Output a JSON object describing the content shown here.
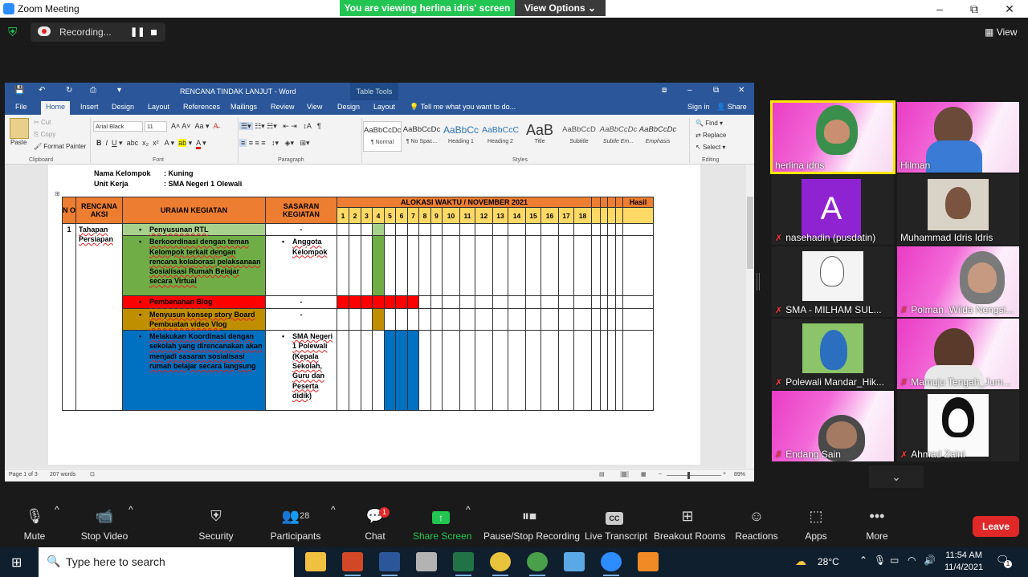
{
  "window": {
    "title": "Zoom Meeting",
    "min": "–",
    "restore": "⧉",
    "close": "✕"
  },
  "banner": {
    "viewing": "You are viewing herlina idris' screen",
    "view_options": "View Options",
    "caret": "⌄"
  },
  "recording": {
    "label": "Recording...",
    "pause": "❚❚"
  },
  "view_button": {
    "label": "View"
  },
  "word": {
    "doc_title": "RENCANA TINDAK LANJUT - Word",
    "table_tools": "Table Tools",
    "tabs": [
      "File",
      "Home",
      "Insert",
      "Design",
      "Layout",
      "References",
      "Mailings",
      "Review",
      "View",
      "Design",
      "Layout"
    ],
    "tell_me": "Tell me what you want to do...",
    "sign_in": "Sign in",
    "share": "Share",
    "clipboard": {
      "paste": "Paste",
      "cut": "Cut",
      "copy": "Copy",
      "format_painter": "Format Painter",
      "group": "Clipboard"
    },
    "font": {
      "name": "Arial Black",
      "size": "11",
      "group": "Font"
    },
    "paragraph_group": "Paragraph",
    "styles": [
      {
        "preview": "AaBbCcDc",
        "name": "¶ Normal"
      },
      {
        "preview": "AaBbCcDc",
        "name": "¶ No Spac..."
      },
      {
        "preview": "AaBbCc",
        "name": "Heading 1"
      },
      {
        "preview": "AaBbCcC",
        "name": "Heading 2"
      },
      {
        "preview": "AaB",
        "name": "Title"
      },
      {
        "preview": "AaBbCcD",
        "name": "Subtitle"
      },
      {
        "preview": "AaBbCcDc",
        "name": "Subtle Em..."
      },
      {
        "preview": "AaBbCcDc",
        "name": "Emphasis"
      }
    ],
    "styles_group": "Styles",
    "editing": {
      "find": "Find",
      "replace": "Replace",
      "select": "Select",
      "group": "Editing"
    },
    "status": {
      "page": "Page 1 of 3",
      "words": "207 words",
      "zoom": "89%"
    }
  },
  "document": {
    "kelompok_label": "Nama Kelompok",
    "kelompok_value": ": Kuning",
    "unit_label": "Unit Kerja",
    "unit_value": ": SMA Negeri 1 Olewali",
    "table": {
      "h_no": "N O",
      "h_aksi": "RENCANA AKSI",
      "h_uraian": "URAIAN KEGIATAN",
      "h_sasaran": "SASARAN KEGIATAN",
      "h_alokasi": "ALOKASI WAKTU / NOVEMBER 2021",
      "h_hasil": "Hasil",
      "days": [
        "1",
        "2",
        "3",
        "4",
        "5",
        "6",
        "7",
        "8",
        "9",
        "10",
        "11",
        "12",
        "13",
        "14",
        "15",
        "16",
        "17",
        "18",
        "",
        "",
        "",
        ""
      ],
      "row_no": "1",
      "row_aksi": "Tahapan Persiapan",
      "rows": [
        {
          "uraian": "Penyusunan RTL",
          "sasaran": "-",
          "color": "lg"
        },
        {
          "uraian": "Berkoordinasi dengan teman Kelompok terkait dengan rencana kolaborasi pelaksanaan Sosialisasi Rumah Belajar secara Virtual",
          "sasaran": "Anggota Kelompok",
          "color": "g"
        },
        {
          "uraian": "Pembenahan Blog",
          "sasaran": "-",
          "color": "r"
        },
        {
          "uraian": "Menyusun konsep story Board Pembuatan video Vlog",
          "sasaran": "-",
          "color": "go"
        },
        {
          "uraian": "Melakukan Koordinasi dengan sekolah yang direncanakan akan menjadi sasaran sosialisasi rumah belajar secara langsung",
          "sasaran": "SMA Negeri 1 Polewali (Kepala Sekolah, Guru dan Peserta didik)",
          "color": "b"
        }
      ]
    }
  },
  "participants_tiles": [
    {
      "name": "herlina idris",
      "muted": false,
      "active": true
    },
    {
      "name": "Hilman",
      "muted": false,
      "active": false
    },
    {
      "name": "nasehadin (pusdatin)",
      "muted": true,
      "avatar": "A"
    },
    {
      "name": "Muhammad Idris Idris",
      "muted": false
    },
    {
      "name": "SMA - MILHAM SUL...",
      "muted": true
    },
    {
      "name": "Polman_Wilda Nengsi...",
      "muted": true
    },
    {
      "name": "Polewali Mandar_Hik...",
      "muted": true
    },
    {
      "name": "Mamuju Tengah_Jum...",
      "muted": true
    },
    {
      "name": "Endang Sain",
      "muted": true
    },
    {
      "name": "Ahmad Zaini",
      "muted": true
    }
  ],
  "toolbar": {
    "mute": "Mute",
    "stop_video": "Stop Video",
    "security": "Security",
    "participants": "Participants",
    "participants_count": "28",
    "chat": "Chat",
    "chat_badge": "1",
    "share_screen": "Share Screen",
    "pause_stop": "Pause/Stop Recording",
    "live_transcript": "Live Transcript",
    "breakout": "Breakout Rooms",
    "reactions": "Reactions",
    "apps": "Apps",
    "more": "More",
    "leave": "Leave"
  },
  "taskbar": {
    "search_placeholder": "Type here to search",
    "temperature": "28°C",
    "time": "11:54 AM",
    "date": "11/4/2021",
    "notif_count": "1"
  },
  "colors": {
    "zoom_green": "#23c552",
    "leave_red": "#e02828",
    "word_blue": "#2b579a",
    "active_speaker": "#ffe600"
  }
}
